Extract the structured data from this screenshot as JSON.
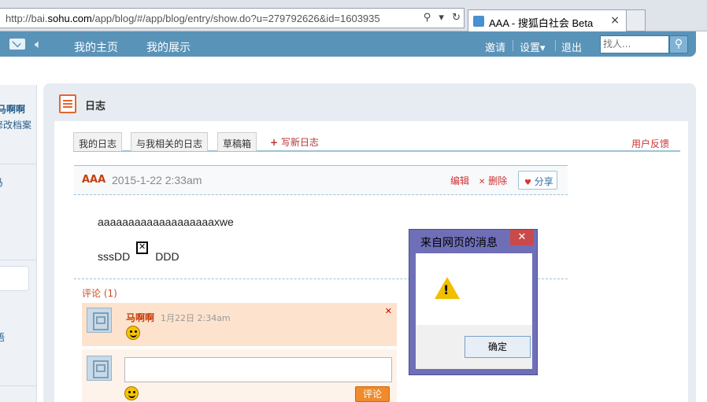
{
  "browser": {
    "url_prefix": "http://bai.",
    "url_domain": "sohu.com",
    "url_rest": "/app/blog/#/app/blog/entry/show.do?u=279792626&id=1603935",
    "tab_title": "AAA - 搜狐白社会 Beta",
    "tab_close": "×"
  },
  "nav": {
    "home": "我的主页",
    "showcase": "我的展示",
    "invite": "邀请",
    "settings": "设置▾",
    "logout": "退出",
    "search_placeholder": "找人..."
  },
  "sidebar": {
    "name": "马啊啊",
    "edit_profile": "修改档案",
    "item_a": "马",
    "item_b": "语"
  },
  "page": {
    "section_title": "日志",
    "tabs": [
      "我的日志",
      "与我相关的日志",
      "草稿箱"
    ],
    "write_new": "写新日志",
    "feedback": "用户反馈"
  },
  "entry": {
    "author": "AAA",
    "date": "2015-1-22 2:33am",
    "edit": "编辑",
    "delete": "删除",
    "share": "分享",
    "body_line1": "aaaaaaaaaaaaaaaaaaaxwe",
    "body_line2_left": "sssDD",
    "body_line2_right": "DDD"
  },
  "comments": {
    "title": "评论 (1)",
    "items": [
      {
        "author": "马啊啊",
        "time": "1月22日 2:34am"
      }
    ],
    "post_button": "评论"
  },
  "dialog": {
    "title": "来自网页的消息",
    "ok": "确定"
  },
  "colors": {
    "nav_bg": "#5a93b8",
    "accent_red": "#c53f0e",
    "dialog_frame": "#6f6fb8"
  }
}
